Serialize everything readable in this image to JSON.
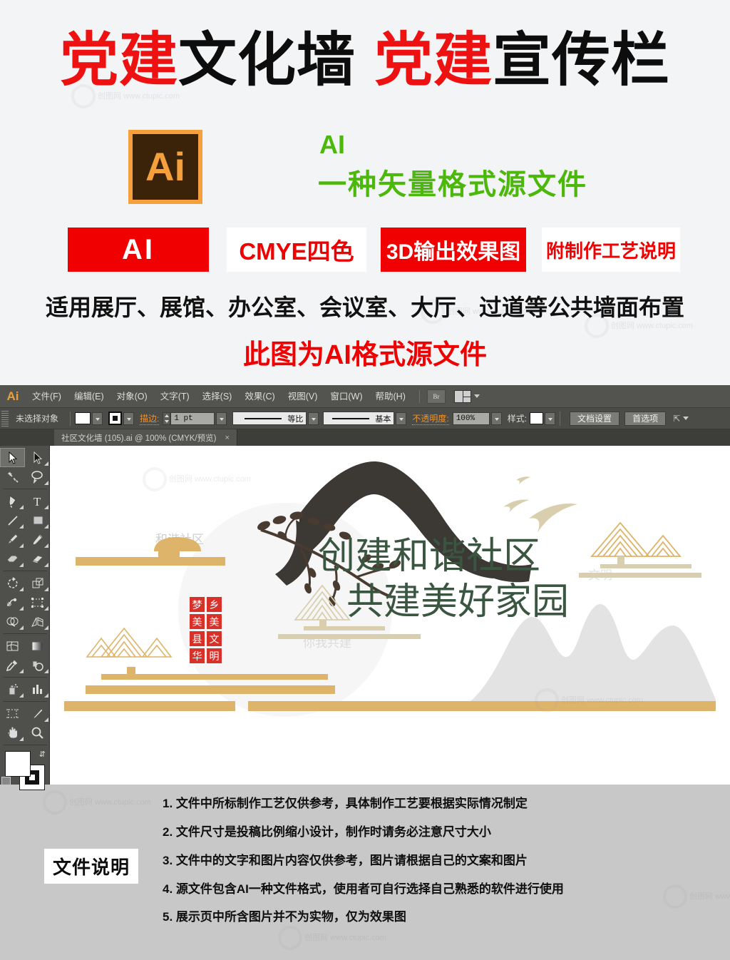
{
  "promo": {
    "title": [
      {
        "text": "党建",
        "color": "#ee1111"
      },
      {
        "text": "文化墙",
        "color": "#0d0d0d"
      },
      {
        "text": "党建",
        "color": "#ee1111"
      },
      {
        "text": "宣传栏",
        "color": "#0d0d0d"
      }
    ],
    "title_parts": {
      "p1": "党建",
      "p2": "文化墙",
      "p3": "党建",
      "p4": "宣传栏"
    },
    "ai_logo_label": "Ai",
    "ai_green_line1": "AI",
    "ai_green_line2": "一种矢量格式源文件",
    "badges": [
      {
        "label": "AI",
        "style": "red"
      },
      {
        "label": "CMYE四色",
        "style": "white"
      },
      {
        "label": "3D输出效果图",
        "style": "red"
      },
      {
        "label": "附制作工艺说明",
        "style": "white"
      }
    ],
    "line1": "适用展厅、展馆、办公室、会议室、大厅、过道等公共墙面布置",
    "line2": "此图为AI格式源文件",
    "colors": {
      "red": "#ee1111",
      "badge_red": "#f00000",
      "green": "#4cb80b",
      "ai_orange": "#f5a03c",
      "ai_brown": "#3b2309"
    },
    "watermark": "创图网 www.ctupic.com"
  },
  "ai_app": {
    "logo": "Ai",
    "menus": [
      "文件(F)",
      "编辑(E)",
      "对象(O)",
      "文字(T)",
      "选择(S)",
      "效果(C)",
      "视图(V)",
      "窗口(W)",
      "帮助(H)"
    ],
    "bridge_label": "Br",
    "control_bar": {
      "selection_status": "未选择对象",
      "stroke_label": "描边:",
      "stroke_width": "1 pt",
      "profile_label": "等比",
      "brush_label": "基本",
      "opacity_label": "不透明度:",
      "opacity_value": "100%",
      "style_label": "样式:",
      "doc_setup_button": "文档设置",
      "preferences_button": "首选项"
    },
    "document_tab": {
      "title": "社区文化墙 (105).ai @ 100% (CMYK/预览)",
      "close": "×"
    },
    "tools": [
      "selection-tool",
      "direct-selection-tool",
      "magic-wand-tool",
      "lasso-tool",
      "pen-tool",
      "type-tool",
      "line-segment-tool",
      "rectangle-tool",
      "paintbrush-tool",
      "pencil-tool",
      "blob-brush-tool",
      "eraser-tool",
      "rotate-tool",
      "scale-tool",
      "width-tool",
      "free-transform-tool",
      "shape-builder-tool",
      "perspective-grid-tool",
      "mesh-tool",
      "gradient-tool",
      "eyedropper-tool",
      "blend-tool",
      "symbol-sprayer-tool",
      "column-graph-tool",
      "artboard-tool",
      "slice-tool",
      "hand-tool",
      "zoom-tool"
    ],
    "color_controls": {
      "fill": "#ffffff",
      "stroke": "#111111",
      "modes": [
        "color",
        "gradient",
        "none"
      ],
      "draw_modes": [
        "draw-normal",
        "draw-behind",
        "draw-inside"
      ]
    }
  },
  "artwork": {
    "headline_line1": "创建和谐社区",
    "headline_line2": "共建美好家园",
    "headline_color": "#3a5540",
    "seal_chars": [
      "梦",
      "乡",
      "美",
      "美",
      "县",
      "文",
      "华",
      "明"
    ],
    "seal_color": "#d8312a",
    "gold": "#ddb46a",
    "sand": "#d9cfae",
    "roof_color": "#3c3834",
    "mountain_gray": "#e3e3e3",
    "watermarks": [
      "和谐社区",
      "你我共建",
      "文明"
    ]
  },
  "footer": {
    "section_label": "文件说明",
    "notes": [
      "1. 文件中所标制作工艺仅供参考，具体制作工艺要根据实际情况制定",
      "2. 文件尺寸是投稿比例缩小设计，制作时请务必注意尺寸大小",
      "3. 文件中的文字和图片内容仅供参考，图片请根据自己的文案和图片",
      "4. 源文件包含AI一种文件格式，使用者可自行选择自己熟悉的软件进行使用",
      "5. 展示页中所含图片并不为实物，仅为效果图"
    ],
    "background": "#c8c8c8"
  }
}
